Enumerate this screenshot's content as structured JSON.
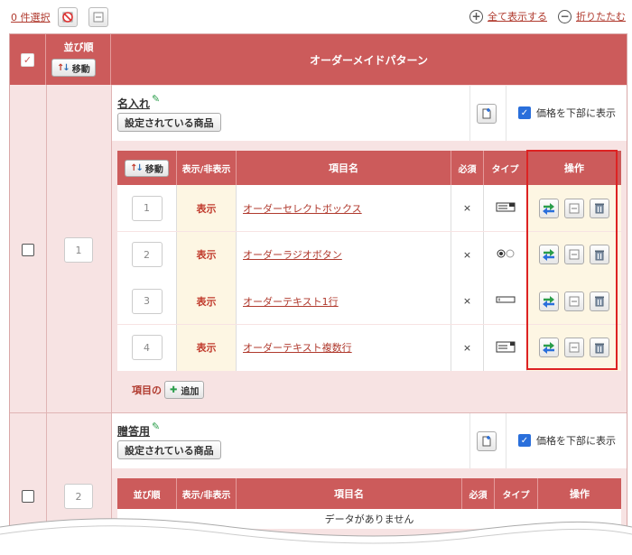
{
  "topbar": {
    "selection_count": "0",
    "selection_label": "件選択",
    "show_all": "全て表示する",
    "collapse": "折りたたむ"
  },
  "header": {
    "order_col": "並び順",
    "move_label": "移動",
    "pattern_col": "オーダーメイドパターン"
  },
  "patterns": [
    {
      "order": "1",
      "name": "名入れ",
      "set_products": "設定されている商品",
      "price_bottom": "価格を下部に表示",
      "price_checked": true,
      "sub_header": {
        "move": "移動",
        "visibility": "表示/非表示",
        "item_name": "項目名",
        "required": "必須",
        "type": "タイプ",
        "actions": "操作"
      },
      "items": [
        {
          "order": "1",
          "visibility": "表示",
          "name": "オーダーセレクトボックス",
          "required": "×",
          "type_icon": "select-box-icon"
        },
        {
          "order": "2",
          "visibility": "表示",
          "name": "オーダーラジオボタン",
          "required": "×",
          "type_icon": "radio-icon"
        },
        {
          "order": "3",
          "visibility": "表示",
          "name": "オーダーテキスト1行",
          "required": "×",
          "type_icon": "text-line-icon"
        },
        {
          "order": "4",
          "visibility": "表示",
          "name": "オーダーテキスト複数行",
          "required": "×",
          "type_icon": "textarea-icon"
        }
      ],
      "add_label_prefix": "項目の",
      "add_button": "追加"
    },
    {
      "order": "2",
      "name": "贈答用",
      "set_products": "設定されている商品",
      "price_bottom": "価格を下部に表示",
      "price_checked": true,
      "sub_header": {
        "order": "並び順",
        "visibility": "表示/非表示",
        "item_name": "項目名",
        "required": "必須",
        "type": "タイプ",
        "actions": "操作"
      },
      "empty_text": "データがありません"
    }
  ],
  "colors": {
    "accent": "#cc5b5b",
    "highlight": "#dd2222"
  }
}
